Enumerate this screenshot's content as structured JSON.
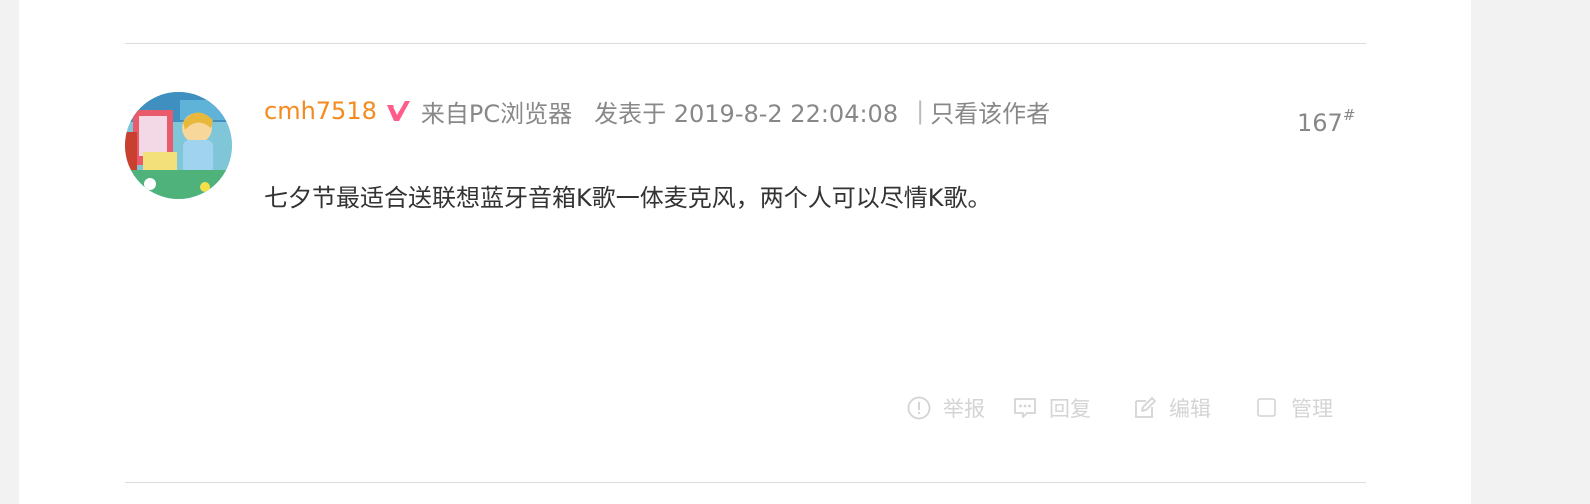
{
  "post": {
    "username": "cmh7518",
    "source": "来自PC浏览器",
    "posted_at": "发表于 2019-8-2 22:04:08",
    "separator": "|",
    "only_author": "只看该作者",
    "floor_number": "167",
    "floor_suffix": "#",
    "content": "七夕节最适合送联想蓝牙音箱K歌一体麦克风，两个人可以尽情K歌。"
  },
  "actions": {
    "report": "举报",
    "reply": "回复",
    "edit": "编辑",
    "manage": "管理"
  },
  "icons": {
    "vip": "vip-badge-icon",
    "report": "exclamation-circle-icon",
    "reply": "speech-bubble-icon",
    "edit": "pencil-square-icon",
    "manage": "checkbox-icon"
  },
  "colors": {
    "username": "#f58a1f",
    "vip_badge": "#ff5c8a",
    "meta_text": "#888888",
    "content_text": "#333333",
    "action_text": "#d4d4d4"
  }
}
